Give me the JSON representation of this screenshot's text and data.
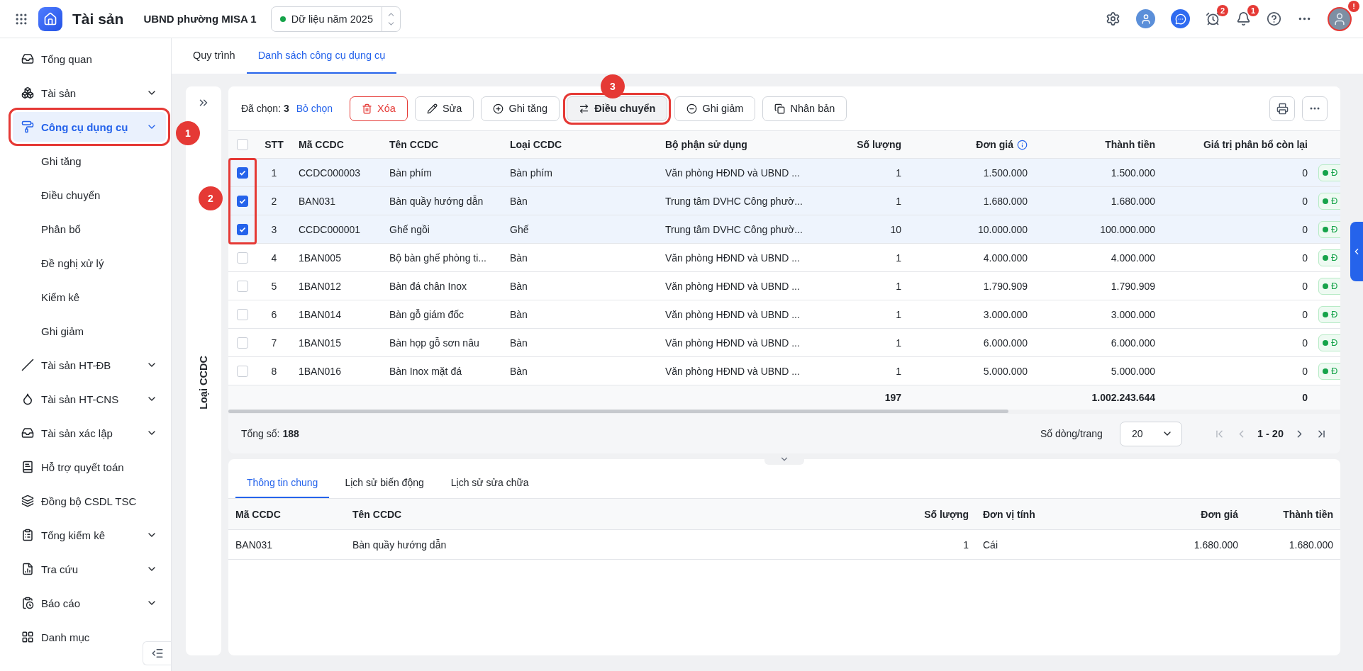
{
  "topbar": {
    "app_name": "Tài sản",
    "org": "UBND phường MISA 1",
    "year_selector": "Dữ liệu năm 2025",
    "timer_badge": "2",
    "bell_badge": "1",
    "avatar_badge": "!"
  },
  "sidebar": {
    "items": [
      {
        "label": "Tổng quan",
        "kind": "link",
        "selected": false,
        "highlighted": false
      },
      {
        "label": "Tài sản",
        "kind": "group",
        "selected": false,
        "highlighted": false
      },
      {
        "label": "Công cụ dụng cụ",
        "kind": "group",
        "expanded": true,
        "selected": true,
        "highlighted": true,
        "children": [
          {
            "label": "Ghi tăng",
            "selected": false
          },
          {
            "label": "Điều chuyển",
            "selected": false
          },
          {
            "label": "Phân bổ",
            "selected": false
          },
          {
            "label": "Đề nghị xử lý",
            "selected": false
          },
          {
            "label": "Kiểm kê",
            "selected": false
          },
          {
            "label": "Ghi giảm",
            "selected": false
          }
        ]
      },
      {
        "label": "Tài sản HT-ĐB",
        "kind": "group",
        "selected": false,
        "highlighted": false
      },
      {
        "label": "Tài sản HT-CNS",
        "kind": "group",
        "selected": false,
        "highlighted": false
      },
      {
        "label": "Tài sản xác lập",
        "kind": "group",
        "selected": false,
        "highlighted": false
      },
      {
        "label": "Hỗ trợ quyết toán",
        "kind": "link",
        "selected": false,
        "highlighted": false
      },
      {
        "label": "Đồng bộ CSDL TSC",
        "kind": "link",
        "selected": false,
        "highlighted": false
      },
      {
        "label": "Tổng kiểm kê",
        "kind": "group",
        "selected": false,
        "highlighted": false
      },
      {
        "label": "Tra cứu",
        "kind": "group",
        "selected": false,
        "highlighted": false
      },
      {
        "label": "Báo cáo",
        "kind": "group",
        "selected": false,
        "highlighted": false
      },
      {
        "label": "Danh mục",
        "kind": "link",
        "selected": false,
        "highlighted": false
      }
    ]
  },
  "tabs": [
    {
      "label": "Quy trình",
      "selected": false
    },
    {
      "label": "Danh sách công cụ dụng cụ",
      "selected": true
    }
  ],
  "filter_panel": {
    "label": "Loại CCDC"
  },
  "toolbar": {
    "selected_info": "Đã chọn: **3**",
    "clear_link": "Bỏ chọn",
    "buttons": [
      {
        "label": "Xóa",
        "kind": "delete",
        "highlighted": false
      },
      {
        "label": "Sửa",
        "kind": "edit",
        "highlighted": false
      },
      {
        "label": "Ghi tăng",
        "kind": "add",
        "highlighted": false
      },
      {
        "label": "Điều chuyển",
        "kind": "transfer",
        "highlighted": true
      },
      {
        "label": "Ghi giảm",
        "kind": "remove",
        "highlighted": false
      },
      {
        "label": "Nhân bản",
        "kind": "copy",
        "highlighted": false
      }
    ]
  },
  "table": {
    "all_checked": false,
    "columns": [
      "STT",
      "Mã CCDC",
      "Tên CCDC",
      "Loại CCDC",
      "Bộ phận sử dụng",
      "Số lượng",
      "Đơn giá",
      "Thành tiền",
      "Giá trị phân bổ còn lại"
    ],
    "rows": [
      {
        "selected": true,
        "highlighted": true,
        "cells": [
          "1",
          "CCDC000003",
          "Bàn phím",
          "Bàn phím",
          "Văn phòng HĐND và UBND ...",
          "1",
          "1.500.000",
          "1.500.000",
          "0"
        ],
        "status": "Đ"
      },
      {
        "selected": true,
        "highlighted": true,
        "cells": [
          "2",
          "BAN031",
          "Bàn quầy hướng dẫn",
          "Bàn",
          "Trung tâm DVHC Công phườ...",
          "1",
          "1.680.000",
          "1.680.000",
          "0"
        ],
        "status": "Đ"
      },
      {
        "selected": true,
        "highlighted": true,
        "cells": [
          "3",
          "CCDC000001",
          "Ghế ngồi",
          "Ghế",
          "Trung tâm DVHC Công phườ...",
          "10",
          "10.000.000",
          "100.000.000",
          "0"
        ],
        "status": "Đ"
      },
      {
        "selected": false,
        "highlighted": false,
        "cells": [
          "4",
          "1BAN005",
          "Bộ bàn ghế phòng ti...",
          "Bàn",
          "Văn phòng HĐND và UBND ...",
          "1",
          "4.000.000",
          "4.000.000",
          "0"
        ],
        "status": "Đ"
      },
      {
        "selected": false,
        "highlighted": false,
        "cells": [
          "5",
          "1BAN012",
          "Bàn đá chân Inox",
          "Bàn",
          "Văn phòng HĐND và UBND ...",
          "1",
          "1.790.909",
          "1.790.909",
          "0"
        ],
        "status": "Đ"
      },
      {
        "selected": false,
        "highlighted": false,
        "cells": [
          "6",
          "1BAN014",
          "Bàn gỗ giám đốc",
          "Bàn",
          "Văn phòng HĐND và UBND ...",
          "1",
          "3.000.000",
          "3.000.000",
          "0"
        ],
        "status": "Đ"
      },
      {
        "selected": false,
        "highlighted": false,
        "cells": [
          "7",
          "1BAN015",
          "Bàn họp gỗ sơn nâu",
          "Bàn",
          "Văn phòng HĐND và UBND ...",
          "1",
          "6.000.000",
          "6.000.000",
          "0"
        ],
        "status": "Đ"
      },
      {
        "selected": false,
        "highlighted": false,
        "cells": [
          "8",
          "1BAN016",
          "Bàn Inox mặt đá",
          "Bàn",
          "Văn phòng HĐND và UBND ...",
          "1",
          "5.000.000",
          "5.000.000",
          "0"
        ],
        "status": "Đ"
      }
    ],
    "totals": {
      "quantity": "197",
      "amount": "1.002.243.644",
      "remaining": "0"
    }
  },
  "pagination": {
    "total": "Tổng số: **188**",
    "rows_per_page_label": "Số dòng/trang",
    "rows_per_page": "20",
    "range": "1 - 20"
  },
  "detail": {
    "tabs": [
      {
        "label": "Thông tin chung",
        "selected": true
      },
      {
        "label": "Lịch sử biến động",
        "selected": false
      },
      {
        "label": "Lịch sử sửa chữa",
        "selected": false
      }
    ],
    "columns": [
      "Mã CCDC",
      "Tên CCDC",
      "Số lượng",
      "Đơn vị tính",
      "Đơn giá",
      "Thành tiền"
    ],
    "rows": [
      [
        "BAN031",
        "Bàn quầy hướng dẫn",
        "1",
        "Cái",
        "1.680.000",
        "1.680.000"
      ]
    ]
  },
  "callouts": [
    "1",
    "2",
    "3"
  ]
}
